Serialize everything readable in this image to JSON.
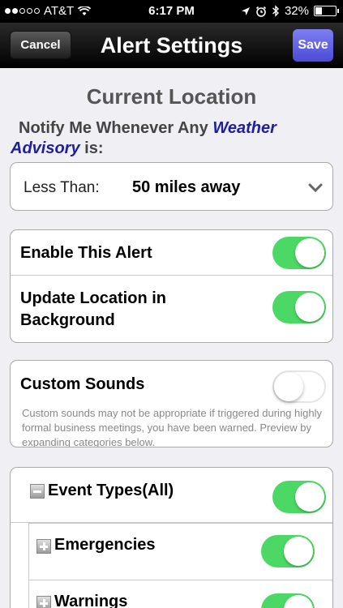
{
  "status_bar": {
    "carrier": "AT&T",
    "time": "6:17 PM",
    "battery": "32%",
    "battery_level": 0.32
  },
  "nav": {
    "back_label": "Cancel",
    "title": "Alert Settings",
    "save_label": "Save"
  },
  "location": {
    "heading": "Current Location",
    "notify_prefix": "Notify Me Whenever Any",
    "notify_highlight_1": "Weather",
    "notify_highlight_2": "Advisory",
    "notify_suffix": "is:"
  },
  "distance": {
    "label": "Less Than:",
    "value": "50 miles away",
    "dropdown_icon": "chevron-down-icon"
  },
  "alerts": {
    "enable_label": "Enable This Alert",
    "enable_on": true,
    "update_label_line1": "Update Location in",
    "update_label_line2": "Background",
    "update_on": true
  },
  "sounds": {
    "label": "Custom Sounds",
    "on": false,
    "note": "Custom sounds may not be appropriate if triggered during highly formal business meetings, you have been warned. Preview by expanding categories below."
  },
  "events": {
    "items": [
      {
        "label": "Event Types(All)",
        "icon": "minus",
        "on": true
      },
      {
        "label": "Emergencies",
        "icon": "+",
        "on": true
      },
      {
        "label": "Warnings",
        "icon": "+",
        "on": true
      }
    ]
  },
  "colors": {
    "toggle_on": "#4cd864",
    "save_button": "#5a5ae0",
    "highlight_text": "#1e1e9e"
  }
}
